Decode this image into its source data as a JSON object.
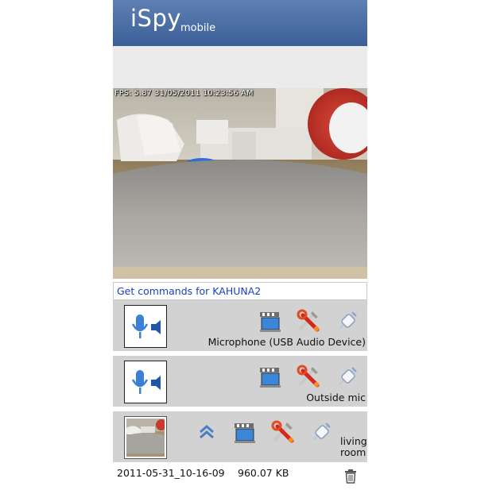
{
  "header": {
    "brand": "iSpy",
    "brand_sub": "mobile"
  },
  "camera_feed": {
    "overlay": "FPS: 5.87 31/05/2011 10:23:56 AM"
  },
  "commands_link": {
    "label": "Get commands for KAHUNA2"
  },
  "devices": [
    {
      "type": "microphone",
      "label": "Microphone (USB Audio Device)",
      "icons": [
        "microphone-icon",
        "video-recorder-icon",
        "settings-tools-icon",
        "connect-plug-icon"
      ]
    },
    {
      "type": "microphone",
      "label": "Outside mic",
      "icons": [
        "microphone-icon",
        "video-recorder-icon",
        "settings-tools-icon",
        "connect-plug-icon"
      ]
    },
    {
      "type": "camera",
      "label": "living room",
      "icons": [
        "camera-thumbnail",
        "chevron-up-icon",
        "video-recorder-icon",
        "settings-tools-icon",
        "connect-plug-icon"
      ]
    }
  ],
  "recording": {
    "file_name": "2011-05-31_10-16-09",
    "file_size": "960.07 KB",
    "delete_icon": "trash-icon"
  },
  "colors": {
    "header_top": "#5f80b4",
    "header_bottom": "#3a5f97",
    "row_bg": "#d2d2d2",
    "link": "#1a3fbf"
  }
}
